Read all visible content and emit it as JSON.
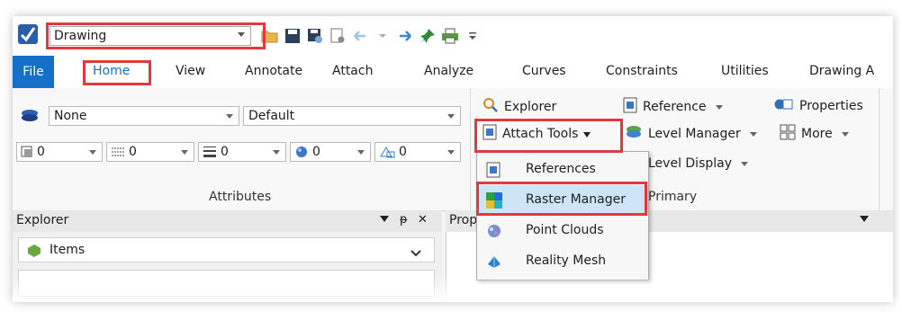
{
  "quick_access": {
    "workflow_value": "Drawing",
    "icons": [
      "open-icon",
      "save-icon",
      "save-settings-icon",
      "properties-icon",
      "undo-icon",
      "redo-icon",
      "pin-icon",
      "print-icon",
      "customize-icon"
    ]
  },
  "tabs": [
    {
      "label": "File"
    },
    {
      "label": "Home"
    },
    {
      "label": "View"
    },
    {
      "label": "Annotate"
    },
    {
      "label": "Attach"
    },
    {
      "label": "Analyze"
    },
    {
      "label": "Curves"
    },
    {
      "label": "Constraints"
    },
    {
      "label": "Utilities"
    },
    {
      "label": "Drawing A"
    }
  ],
  "attributes": {
    "level_value": "None",
    "style_value": "Default",
    "color_value": "0",
    "line_style_value": "0",
    "weight_value": "0",
    "transparency_value": "0",
    "priority_value": "0",
    "group_label": "Attributes"
  },
  "primary": {
    "explorer": "Explorer",
    "attach_tools": "Attach Tools",
    "reference": "Reference",
    "level_manager": "Level Manager",
    "level_display": "Level Display",
    "properties": "Properties",
    "more": "More",
    "group_label": "Primary"
  },
  "attach_menu": [
    {
      "label": "References"
    },
    {
      "label": "Raster Manager"
    },
    {
      "label": "Point Clouds"
    },
    {
      "label": "Reality Mesh"
    }
  ],
  "explorer_panel": {
    "title": "Explorer",
    "pin": "ᵽ",
    "close": "✕",
    "item": "Items"
  },
  "properties_panel": {
    "title": "Prop"
  },
  "colors": {
    "accent": "#1670c7",
    "highlight": "#e03a3e",
    "menu_highlight": "#cde6f7"
  }
}
